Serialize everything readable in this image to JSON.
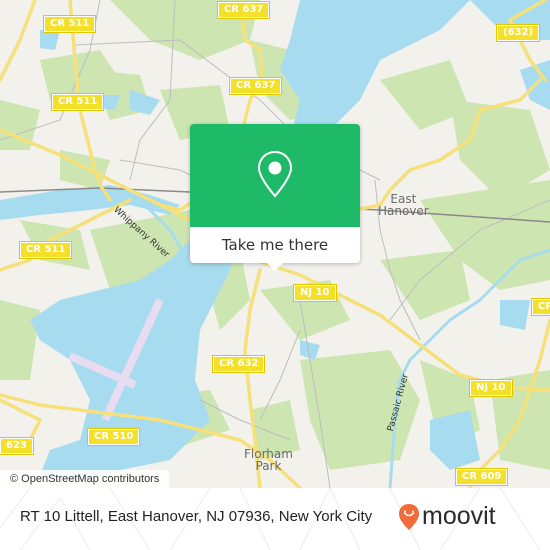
{
  "map": {
    "attribution": "© OpenStreetMap contributors",
    "colors": {
      "land": "#f2f1ec",
      "water": "#a7dbef",
      "park": "#cde5b1",
      "road": "#f5e07a",
      "runway": "#e7dcf0",
      "rail": "#888888"
    },
    "road_shields": [
      {
        "id": "cr637-top",
        "label": "CR 637"
      },
      {
        "id": "cr511-top",
        "label": "CR 511"
      },
      {
        "id": "cr637-mid",
        "label": "CR 637"
      },
      {
        "id": "cr511-mid",
        "label": "CR 511"
      },
      {
        "id": "cr511-low",
        "label": "CR 511"
      },
      {
        "id": "r632",
        "label": "(632)"
      },
      {
        "id": "nj10-a",
        "label": "NJ 10"
      },
      {
        "id": "cr632",
        "label": "CR 632"
      },
      {
        "id": "nj10-b",
        "label": "NJ 10"
      },
      {
        "id": "cr510",
        "label": "CR 510"
      },
      {
        "id": "r623",
        "label": "623"
      },
      {
        "id": "cr609",
        "label": "CR 609"
      },
      {
        "id": "cr-right",
        "label": "CR"
      }
    ],
    "places": [
      {
        "id": "east-hanover",
        "line1": "East",
        "line2": "Hanover"
      },
      {
        "id": "florham-park",
        "line1": "Florham",
        "line2": "Park"
      }
    ],
    "rivers": [
      {
        "id": "whippany",
        "label": "Whippany River"
      },
      {
        "id": "passaic",
        "label": "Passaic River"
      }
    ]
  },
  "popup": {
    "icon": "location-pin-icon",
    "button_label": "Take me there"
  },
  "footer": {
    "address": "RT 10 Littell, East Hanover, NJ 07936, New York City",
    "brand": "moovit",
    "brand_color": "#f26b3a"
  }
}
